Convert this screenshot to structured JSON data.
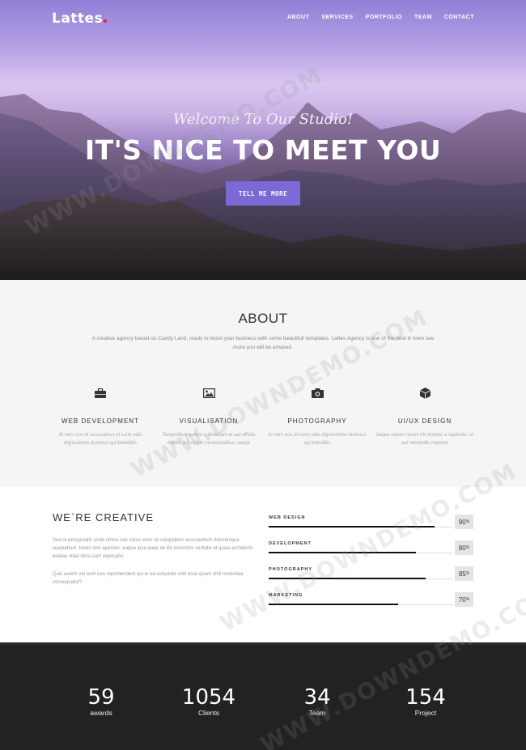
{
  "brand": {
    "name": "Lattes",
    "dot_color": "#e5234a"
  },
  "nav": [
    "ABOUT",
    "SERVICES",
    "PORTFOLIO",
    "TEAM",
    "CONTACT"
  ],
  "hero": {
    "welcome": "Welcome To Our Studio!",
    "headline": "IT'S NICE TO MEET YOU",
    "cta": "TELL ME MORE",
    "cta_color": "#7b6ad6"
  },
  "about": {
    "title": "ABOUT",
    "description": "A creative agency based on Candy Land, ready to boost your business with some beautifull templates. Lattes Agency is one of the best in town see more you will be amazed.",
    "services": [
      {
        "icon": "briefcase-icon",
        "name": "WEB DEVELOPMENT",
        "text": "At vero eos et accusamus et iusto odio dignissimos ducimus qui blanditiis"
      },
      {
        "icon": "image-icon",
        "name": "VISUALISATION",
        "text": "Temporibus autem quibusdam et aut officiis debitis aut rerum necessitatibus saepe"
      },
      {
        "icon": "camera-icon",
        "name": "PHOTOGRAPHY",
        "text": "At vero eos et iusto odio dignissimos ducimus qui blanditiis"
      },
      {
        "icon": "cube-icon",
        "name": "UI/UX DESIGN",
        "text": "Itaque earum rerum hic tenetur a sapiente, ut aut reiciendis maiores"
      }
    ]
  },
  "creative": {
    "title": "WE`RE CREATIVE",
    "paragraph1": "Sed ut perspiciatis unde omnis iste natus error sit voluptatem accusantium doloremque laudantium, totam rem aperiam, eaque ipsa quae ab illo inventore veritatis et quasi architecto beatae vitae dicta sunt explicabo.",
    "paragraph2": "Quis autem vel eum iure reprehenderit qui in ea voluptate velit esse quam nihil molestiae consequatur?",
    "skills": [
      {
        "label": "WEB DESIGN",
        "value": "90",
        "fraction": 0.9
      },
      {
        "label": "DEVELOPMENT",
        "value": "80",
        "fraction": 0.8
      },
      {
        "label": "PHOTOGRAPHY",
        "value": "85",
        "fraction": 0.85
      },
      {
        "label": "MARKETING",
        "value": "70",
        "fraction": 0.7
      }
    ],
    "pct_symbol": "%"
  },
  "counters": [
    {
      "value": "59",
      "label": "awards"
    },
    {
      "value": "1054",
      "label": "Clients"
    },
    {
      "value": "34",
      "label": "Team"
    },
    {
      "value": "154",
      "label": "Project"
    }
  ],
  "watermark": "WWW.DOWNDEMO.COM"
}
